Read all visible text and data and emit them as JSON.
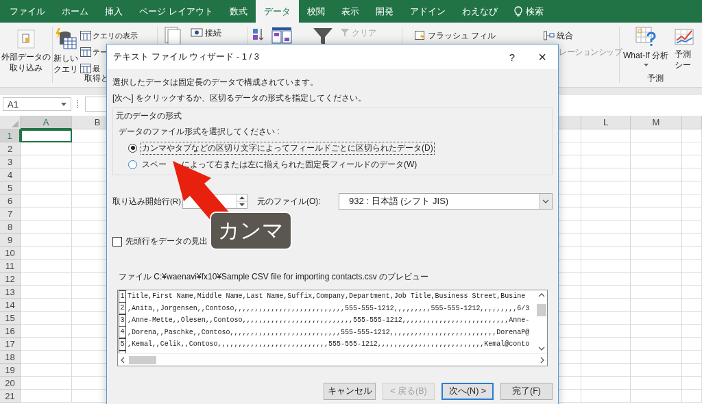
{
  "ribbon_tabs": [
    {
      "label": "ファイル",
      "selected": false
    },
    {
      "label": "ホーム",
      "selected": false
    },
    {
      "label": "挿入",
      "selected": false
    },
    {
      "label": "ページ レイアウト",
      "selected": false
    },
    {
      "label": "数式",
      "selected": false
    },
    {
      "label": "データ",
      "selected": true
    },
    {
      "label": "校閲",
      "selected": false
    },
    {
      "label": "表示",
      "selected": false
    },
    {
      "label": "開発",
      "selected": false
    },
    {
      "label": "アドイン",
      "selected": false
    },
    {
      "label": "わえなび",
      "selected": false
    }
  ],
  "tell_me": "検索",
  "ribbon": {
    "get_external_data": [
      "外部データの",
      "取り込み"
    ],
    "new_query": [
      "新しい",
      "クエリ"
    ],
    "query_items": [
      {
        "label": "クエリの表示"
      },
      {
        "label": "テー"
      },
      {
        "label": "最"
      }
    ],
    "get_group_label": "取得と",
    "connections": "接続",
    "clear": {
      "label": "クリア",
      "disabled": true
    },
    "flash_fill": {
      "label": "フラッシュ フィル",
      "disabled": false
    },
    "consolidate": {
      "label": "統合",
      "disabled": false
    },
    "relationships": {
      "label": "レーションシップ",
      "disabled": true
    },
    "what_if": "What-If 分析",
    "forecast_sheet": [
      "予測",
      "シー"
    ],
    "forecast_group_label": "予測"
  },
  "name_box": "A1",
  "sheet": {
    "columns": [
      {
        "label": "A",
        "selected": true
      },
      {
        "label": "B",
        "selected": false
      },
      {
        "label": "L",
        "selected": false
      },
      {
        "label": "M",
        "selected": false
      }
    ],
    "rows": [
      {
        "label": "1",
        "selected": true
      },
      {
        "label": "2",
        "selected": false
      },
      {
        "label": "3",
        "selected": false
      },
      {
        "label": "4",
        "selected": false
      },
      {
        "label": "5",
        "selected": false
      },
      {
        "label": "6",
        "selected": false
      },
      {
        "label": "7",
        "selected": false
      },
      {
        "label": "8",
        "selected": false
      },
      {
        "label": "9",
        "selected": false
      },
      {
        "label": "10",
        "selected": false
      },
      {
        "label": "11",
        "selected": false
      },
      {
        "label": "12",
        "selected": false
      },
      {
        "label": "13",
        "selected": false
      },
      {
        "label": "14",
        "selected": false
      },
      {
        "label": "15",
        "selected": false
      },
      {
        "label": "16",
        "selected": false
      },
      {
        "label": "17",
        "selected": false
      },
      {
        "label": "18",
        "selected": false
      },
      {
        "label": "19",
        "selected": false
      },
      {
        "label": "20",
        "selected": false
      },
      {
        "label": "21",
        "selected": false
      }
    ]
  },
  "dialog": {
    "title": "テキスト ファイル ウィザード - 1 / 3",
    "help": "?",
    "close": "×",
    "intro": [
      "選択したデータは固定長のデータで構成されています。",
      "[次へ] をクリックするか、区切るデータの形式を指定してください。"
    ],
    "format_group": {
      "legend": "元のデータの形式",
      "prompt": "データのファイル形式を選択してください :",
      "options": [
        {
          "parts": [
            "カンマやタブなどの区切り文字によってフィールドごとに区切られたデータ(D)"
          ],
          "selected": true
        },
        {
          "parts": [
            "スペー",
            "によって右または左に揃えられた固定長フィールドのデータ(W)"
          ],
          "selected": false
        }
      ]
    },
    "start_row_label": "取り込み開始行(R)",
    "origin_label": "元のファイル(O):",
    "origin_value": "932 : 日本語 (シフト JIS)",
    "header_checkbox": {
      "label": "先頭行をデータの見出",
      "checked": false
    },
    "preview_label": "ファイル C:¥waenavi¥fx10¥Sample CSV file for importing contacts.csv のプレビュー",
    "preview_lines": [
      {
        "no": "1",
        "text": "Title,First Name,Middle Name,Last Name,Suffix,Company,Department,Job Title,Business Street,Busine"
      },
      {
        "no": "2",
        "text": ",Anita,,Jorgensen,,Contoso,,,,,,,,,,,,,,,,,,,,,,,,,,,555-555-1212,,,,,,,,,555-555-1212,,,,,,,,,6/3"
      },
      {
        "no": "3",
        "text": ",Anne-Mette,,Olesen,,Contoso,,,,,,,,,,,,,,,,,,,,,,,,,,,555-555-1212,,,,,,,,,,,,,,,,,,,,,,,,,,Anne-"
      },
      {
        "no": "4",
        "text": ",Dorena,,Paschke,,Contoso,,,,,,,,,,,,,,,,,,,,,,,,,,,555-555-1212,,,,,,,,,,,,,,,,,,,,,,,,,,DorenaP@"
      },
      {
        "no": "5",
        "text": ",Kemal,,Celik,,Contoso,,,,,,,,,,,,,,,,,,,,,,,,,,,555-555-1212,,,,,,,,,,,,,,,,,,,,,,,,,,Kemal@conto"
      }
    ],
    "buttons": [
      {
        "label": "キャンセル",
        "kind": "normal",
        "disabled": false
      },
      {
        "label": "< 戻る(B)",
        "kind": "normal",
        "disabled": true
      },
      {
        "label": "次へ(N) >",
        "kind": "default",
        "disabled": false
      },
      {
        "label": "完了(F)",
        "kind": "normal",
        "disabled": false
      }
    ]
  },
  "callout": "カンマ"
}
